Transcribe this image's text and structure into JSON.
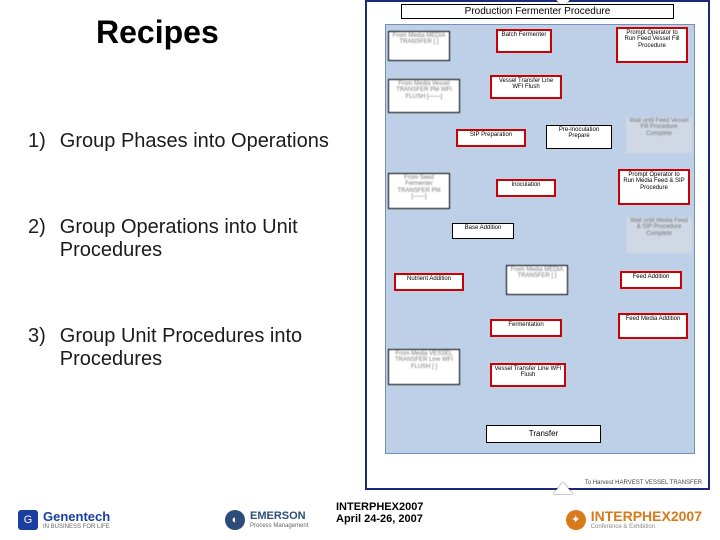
{
  "title": "Recipes",
  "items": [
    {
      "num": "1)",
      "text": "Group Phases into Operations"
    },
    {
      "num": "2)",
      "text": "Group Operations into Unit Procedures"
    },
    {
      "num": "3)",
      "text": "Group Unit Procedures into Procedures"
    }
  ],
  "diagram": {
    "heading": "Production  Fermenter Procedure",
    "boxes": {
      "mediaTransfer1": "From Media\nMEDIA TRANSFER\n[ ]",
      "batchFermenter": "Batch\nFermenter",
      "promptOp1": "Prompt Operator\nto Run\nFeed Vessel Fill\nProcedure",
      "fromMediaVessel": "From Media\nVessel TRANSFER PM\nWFI FLUSH\n[——]",
      "vesselTransfer1": "Vessel Transfer\nLine WFI Flush",
      "sipPrep": "SIP Preparation",
      "preInoc": "Pre-Inoculation\nPrepare",
      "waitFeed": "Wait until Feed\nVessel Fill\nProcedure\nComplete",
      "fromSeed": "From Seed\nFermenter\nTRANSFER PM\n[——]",
      "inoculation": "Inoculation",
      "promptOp2": "Prompt Operator\nto Run\nMedia Feed & SIP\nProcedure",
      "baseAddition": "Base Addition",
      "waitMedia": "Wait until Media\nFeed & SIP\nProcedure\nComplete",
      "nutrientAdd": "Nutrient Addition",
      "mediaTransfer2": "From Media\nMEDIA TRANSFER\n[ ]",
      "feedAddition": "Feed Addition",
      "fermentation": "Fermentation",
      "fromMediaVessel2": "From Media\nVESSEL TRANSFER\nLine WFI FLUSH\n[ ]",
      "feedMediaAdd": "Feed Media\nAddition",
      "vesselTransfer2": "Vessel Transfer\nLine WFI Flush",
      "transfer": "Transfer",
      "harvest": "To Harvest\nHARVEST VESSEL\nTRANSFER"
    }
  },
  "footer": {
    "logo1": {
      "name": "Genentech",
      "tag": "IN BUSINESS FOR LIFE"
    },
    "logo2": {
      "name": "EMERSON",
      "tag": "Process Management"
    },
    "logo3": {
      "name": "INTERPHEX2007",
      "tag": "Conference & Exhibition"
    },
    "conf_line1": "INTERPHEX2007",
    "conf_line2": "April 24-26, 2007"
  }
}
